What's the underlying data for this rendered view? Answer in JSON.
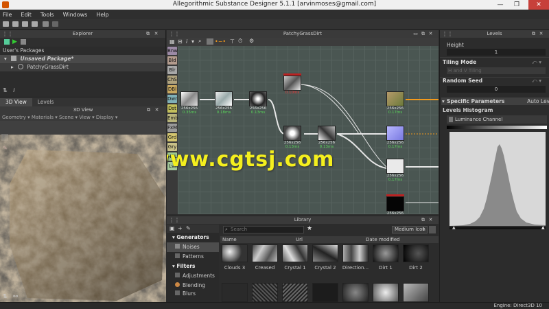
{
  "window": {
    "title": "Allegorithmic Substance Designer 5.1.1 [arvinmoses@gmail.com]"
  },
  "menu": [
    "File",
    "Edit",
    "Tools",
    "Windows",
    "Help"
  ],
  "explorer": {
    "header": "Explorer",
    "section": "User's Packages",
    "package": "Unsaved Package*",
    "graph": "PatchyGrassDirt"
  },
  "view3d": {
    "tabs": [
      "3D View",
      "Levels"
    ],
    "header": "3D View",
    "menu": [
      "Geometry ▾",
      "Materials ▾",
      "Scene ▾",
      "View ▾",
      "Display ▾"
    ]
  },
  "graph": {
    "header": "PatchyGrassDirt",
    "categories": [
      "Bnw",
      "Bld",
      "Blr",
      "ChS",
      "DBl",
      "Dwr",
      "Dst",
      "Emb",
      "FxM",
      "Grd",
      "Gry",
      "HSL",
      "Lvl"
    ],
    "nodes": [
      {
        "size": "256x256",
        "time": "0.35ms"
      },
      {
        "size": "256x256",
        "time": "0.18ms"
      },
      {
        "size": "256x256",
        "time": "0.13ms"
      },
      {
        "size": "256x256",
        "time": "0.10ms"
      },
      {
        "size": "256x256",
        "time": "0.13ms"
      },
      {
        "size": "256x256",
        "time": "0.13ms"
      },
      {
        "size": "256x256",
        "time": "0.17ms"
      },
      {
        "size": "256x256",
        "time": "0.17ms"
      },
      {
        "size": "256x256",
        "time": "0.17ms"
      },
      {
        "size": "256x256",
        "time": ""
      }
    ],
    "watermark": "www.cgtsj.com"
  },
  "library": {
    "header": "Library",
    "search_placeholder": "Search",
    "view_mode": "Medium Icon",
    "columns": [
      "Name",
      "Url",
      "Date modified"
    ],
    "sections": [
      {
        "title": "Generators",
        "items": [
          "Noises",
          "Patterns"
        ]
      },
      {
        "title": "Filters",
        "items": [
          "Adjustments",
          "Blending",
          "Blurs"
        ]
      }
    ],
    "thumbs": [
      "Clouds 3",
      "Creased",
      "Crystal 1",
      "Crystal 2",
      "Direction...",
      "Dirt 1",
      "Dirt 2"
    ]
  },
  "levels": {
    "header": "Levels",
    "height_label": "Height",
    "height_value": "1",
    "tiling_label": "Tiling Mode",
    "tiling_value": "H and V Tiling",
    "seed_label": "Random Seed",
    "seed_value": "0",
    "specific": "Specific Parameters",
    "auto": "Auto Lev",
    "histogram_label": "Levels Histogram",
    "channel": "Luminance Channel"
  },
  "status": {
    "engine": "Engine: Direct3D 10"
  },
  "colors": {
    "accent_orange": "#f39a1c",
    "watermark": "#f4ef1e"
  }
}
